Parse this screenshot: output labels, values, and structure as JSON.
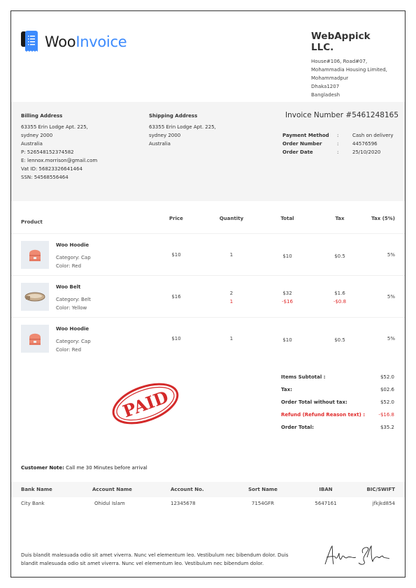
{
  "logo": {
    "part1": "Woo",
    "part2": "Invoice"
  },
  "company": {
    "name": "WebAppick LLC.",
    "address": [
      "House#106, Road#07,",
      "Mohammadia Housing Limited,",
      "Mohammadpur",
      "Dhaka1207",
      "Bangladesh"
    ]
  },
  "billing": {
    "title": "Billing Address",
    "lines": [
      "63355 Erin Lodge Apt. 225,",
      "sydney 2000",
      "Australia",
      "P: 526548152374582",
      "E: lennox.morrison@gmail.com",
      "Vat ID: 56823326641464",
      "SSN: 54568556464"
    ]
  },
  "shipping": {
    "title": "Shipping Address",
    "lines": [
      "63355 Erin Lodge Apt. 225,",
      "sydney 2000",
      "Australia"
    ]
  },
  "invoice": {
    "title": "Invoice Number #5461248165",
    "meta": [
      {
        "k": "Payment Method",
        "c": ":",
        "v": "Cash on delivery"
      },
      {
        "k": "Order Number",
        "c": ":",
        "v": "44576596"
      },
      {
        "k": "Order Date",
        "c": ":",
        "v": "25/10/2020"
      }
    ]
  },
  "table": {
    "headers": [
      "Product",
      "Price",
      "Quantity",
      "Total",
      "Tax",
      "Tax (5%)"
    ],
    "rows": [
      {
        "name": "Woo Hoodie",
        "category": "Category: Cap",
        "color": "Color: Red",
        "price": "$10",
        "qty": "1",
        "qty_refund": "",
        "total": "$10",
        "total_refund": "",
        "tax": "$0.5",
        "tax_refund": "",
        "rate": "5%"
      },
      {
        "name": "Woo Belt",
        "category": "Category: Belt",
        "color": "Color: Yellow",
        "price": "$16",
        "qty": "2",
        "qty_refund": "1",
        "total": "$32",
        "total_refund": "-$16",
        "tax": "$1.6",
        "tax_refund": "-$0.8",
        "rate": "5%"
      },
      {
        "name": "Woo Hoodie",
        "category": "Category: Cap",
        "color": "Color: Red",
        "price": "$10",
        "qty": "1",
        "qty_refund": "",
        "total": "$10",
        "total_refund": "",
        "tax": "$0.5",
        "tax_refund": "",
        "rate": "5%"
      }
    ]
  },
  "totals": [
    {
      "l": "Items Subtotal :",
      "v": "$52.0"
    },
    {
      "l": "Tax:",
      "v": "$02.6"
    },
    {
      "l": "Order Total without tax:",
      "v": "$52.0"
    },
    {
      "l": "Refund (Refund Reason text) :",
      "v": "-$16.8"
    },
    {
      "l": "Order Total:",
      "v": "$35.2"
    }
  ],
  "stamp": "PAID",
  "note": {
    "label": "Customer Note:",
    "text": " Call me 30 Minutes before arrival"
  },
  "bank": {
    "headers": [
      "Bank Name",
      "Account Name",
      "Account No.",
      "Sort Name",
      "IBAN",
      "BIC/SWIFT"
    ],
    "values": [
      "City Bank",
      "Ohidul Islam",
      "12345678",
      "7154GFR",
      "5647161",
      "jfkjkd854"
    ]
  },
  "footer": {
    "text": "Duis blandit malesuada odio sit amet viverra. Nunc vel elementum leo. Vestibulum nec bibendum dolor. Duis blandit malesuada odio sit amet viverra. Nunc vel elementum leo. Vestibulum nec bibendum dolor.",
    "signature": "Amber Sheen"
  },
  "colors": {
    "accent": "#3d8bfd",
    "refund": "#e02b2b",
    "stamp": "#d42a2a"
  }
}
